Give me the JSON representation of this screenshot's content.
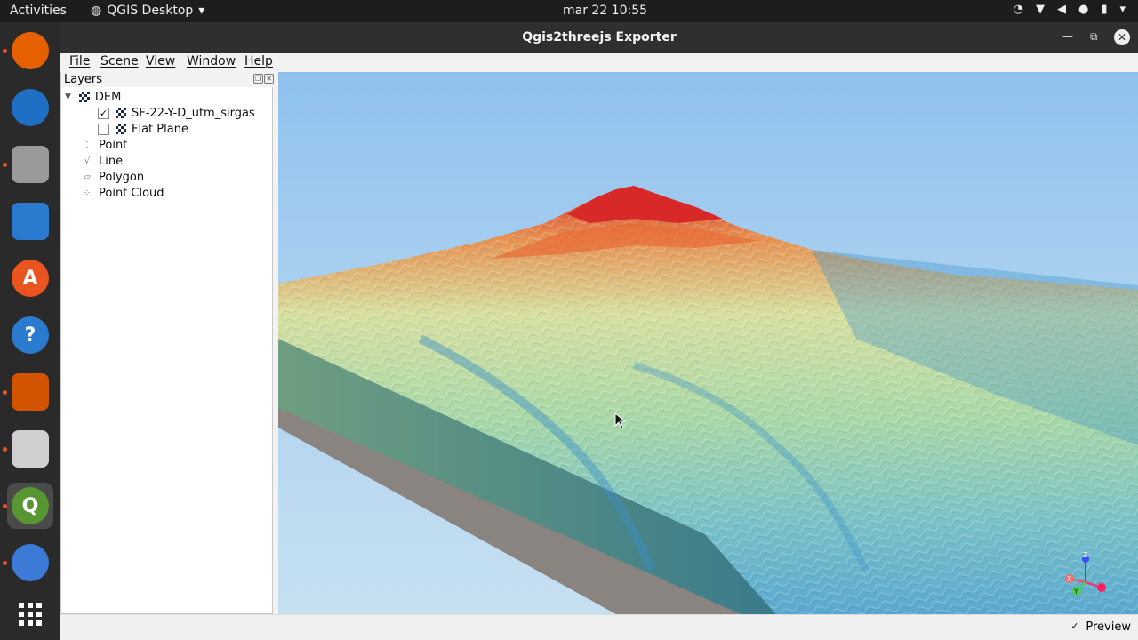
{
  "topbar": {
    "activities": "Activities",
    "app_name": "QGIS Desktop",
    "clock": "mar 22  10:55"
  },
  "dock": {
    "items": [
      {
        "name": "firefox-icon",
        "glyph": "",
        "color": "#e66000"
      },
      {
        "name": "thunderbird-icon",
        "glyph": "",
        "color": "#1f6fc5"
      },
      {
        "name": "files-icon",
        "glyph": "",
        "color": "#9a9a9a"
      },
      {
        "name": "writer-icon",
        "glyph": "",
        "color": "#2a7bd0"
      },
      {
        "name": "software-center-icon",
        "glyph": "A",
        "color": "#e95420"
      },
      {
        "name": "help-icon",
        "glyph": "?",
        "color": "#2a7bd0"
      },
      {
        "name": "impress-icon",
        "glyph": "",
        "color": "#d35400"
      },
      {
        "name": "document-viewer-icon",
        "glyph": "",
        "color": "#d0d0d0"
      },
      {
        "name": "qgis-icon",
        "glyph": "Q",
        "color": "#589632"
      },
      {
        "name": "chromium-icon",
        "glyph": "",
        "color": "#3b7bd6"
      },
      {
        "name": "show-apps-icon",
        "glyph": "",
        "color": "transparent"
      }
    ]
  },
  "window": {
    "title": "Qgis2threejs Exporter",
    "menu": [
      "File",
      "Scene",
      "View",
      "Window",
      "Help"
    ]
  },
  "layers_panel": {
    "title": "Layers",
    "dem_label": "DEM",
    "dem_children": [
      {
        "label": "SF-22-Y-D_utm_sirgas",
        "checked": "✓"
      },
      {
        "label": "Flat Plane",
        "checked": ""
      }
    ],
    "groups": [
      "Point",
      "Line",
      "Polygon",
      "Point Cloud"
    ]
  },
  "axes_labels": {
    "x": "X",
    "y": "Y",
    "z": "Z"
  },
  "statusbar": {
    "preview_label": "Preview",
    "preview_check": "✓"
  },
  "colors": {
    "sky": "#a9d0ef",
    "terrain_low": "#3a8fd0",
    "terrain_mid": "#b9e0a0",
    "terrain_high": "#e03030",
    "base": "#8a8480"
  }
}
